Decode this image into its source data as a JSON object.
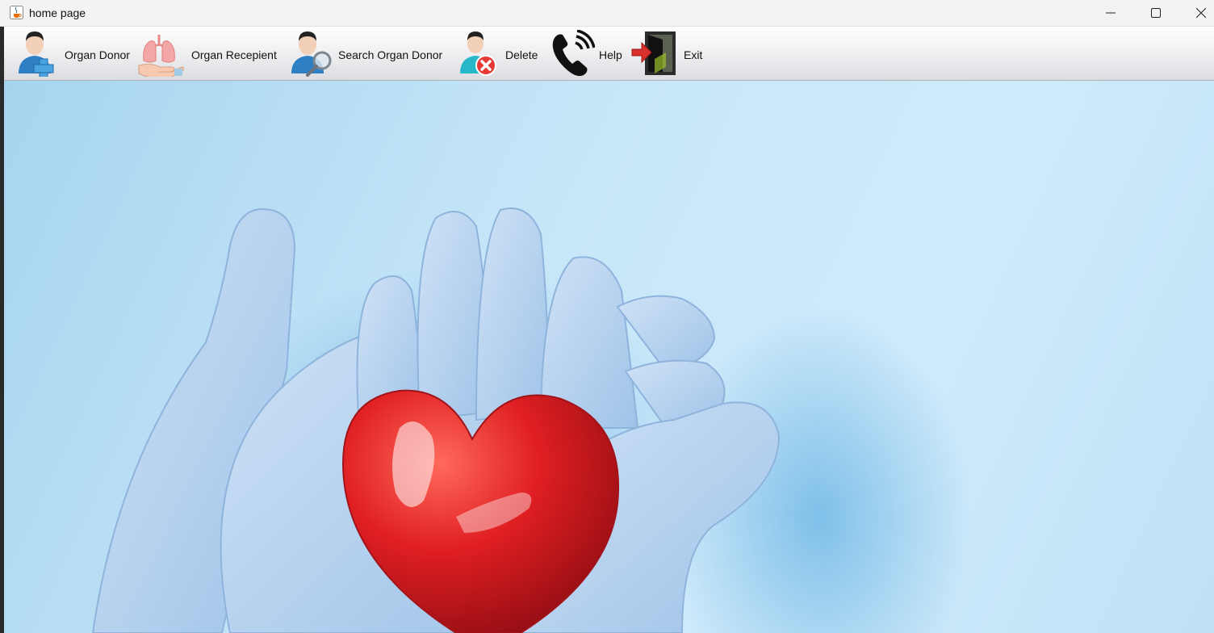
{
  "window": {
    "title": "home page"
  },
  "toolbar": {
    "items": [
      {
        "label": "Organ Donor",
        "icon": "add-user-icon"
      },
      {
        "label": "Organ Recepient",
        "icon": "lungs-hand-icon"
      },
      {
        "label": "Search Organ Donor",
        "icon": "search-user-icon"
      },
      {
        "label": "Delete",
        "icon": "delete-user-icon"
      },
      {
        "label": "Help",
        "icon": "phone-icon"
      },
      {
        "label": "Exit",
        "icon": "exit-door-icon"
      }
    ]
  },
  "main": {
    "background_image": "gloved hands holding red heart"
  },
  "colors": {
    "toolbar_bg": "#e4e5e8",
    "content_bg": "#c6e6f8",
    "heart": "#d7191c",
    "glove": "#b6d3ef"
  }
}
